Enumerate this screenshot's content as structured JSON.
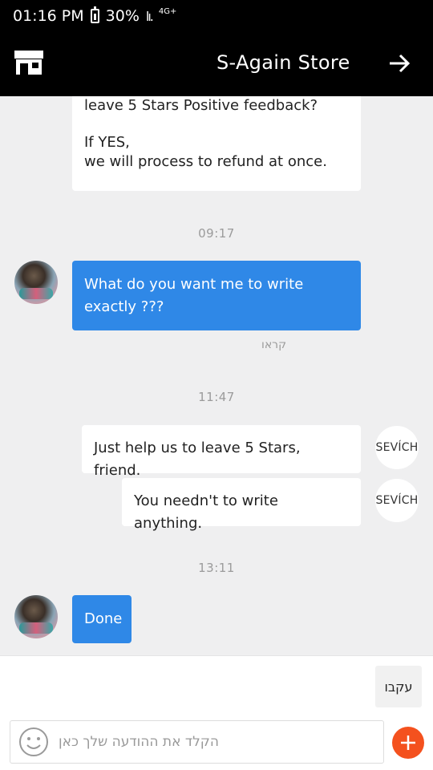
{
  "status_bar": {
    "time": "01:16 PM",
    "battery": "30%",
    "signal": "lı.",
    "network": "4G+"
  },
  "header": {
    "title": "S-Again Store",
    "icons": [
      "store-icon",
      "arrow-right-icon"
    ]
  },
  "messages": [
    {
      "side": "received",
      "lines": [
        "leave 5 Stars Positive feedback?",
        "",
        "If YES,",
        "we will process to refund at once."
      ]
    },
    {
      "type": "time",
      "text": "09:17"
    },
    {
      "side": "sent",
      "lines": [
        "What do you want me to write",
        "exactly ???"
      ]
    },
    {
      "type": "read_receipt",
      "text": "קראו"
    },
    {
      "type": "time",
      "text": "11:47"
    },
    {
      "side": "received",
      "lines": [
        "Just help us to leave 5 Stars, friend."
      ],
      "avatar": "SEVÍCH"
    },
    {
      "side": "received",
      "lines": [
        "You needn't to write anything."
      ],
      "avatar": "SEVÍCH"
    },
    {
      "type": "time",
      "text": "13:11"
    },
    {
      "side": "sent",
      "lines": [
        "Done"
      ]
    }
  ],
  "composer": {
    "quick_reply": "עקבו",
    "placeholder": "הקלד את ההודעה שלך כאן",
    "value": ""
  },
  "colors": {
    "sent_bubble": "#2f88e7",
    "received_bubble": "#ffffff",
    "add_button": "#f4511e",
    "chat_bg": "#efeff0"
  }
}
